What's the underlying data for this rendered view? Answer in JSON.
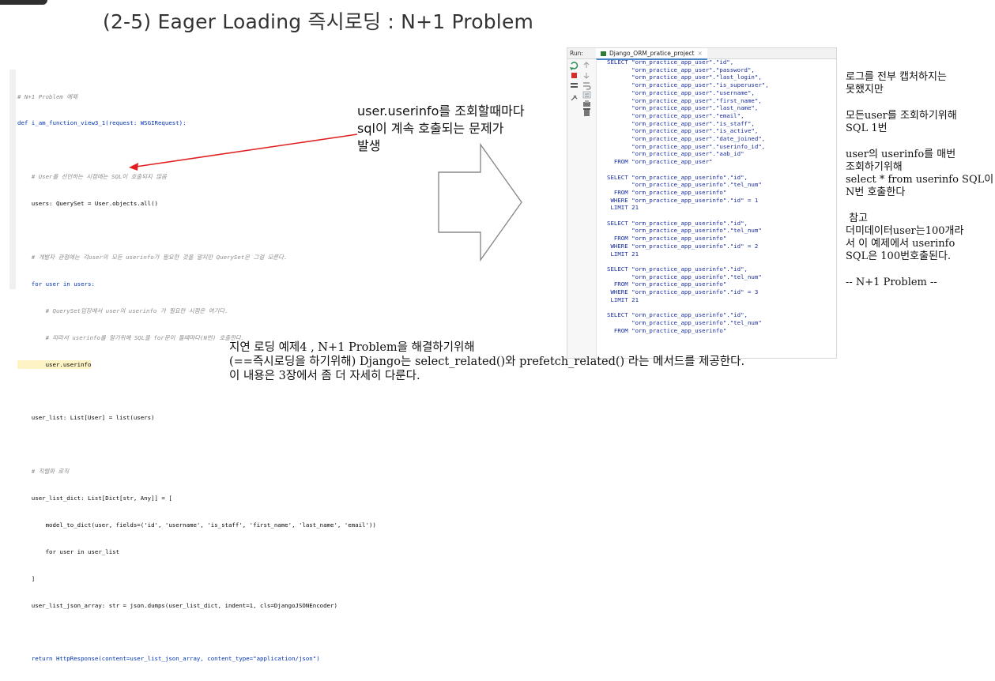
{
  "slide": {
    "title": "(2-5) Eager Loading 즉시로딩 : N+1 Problem"
  },
  "code": {
    "lines": [
      "# N+1 Problem 예제",
      "def i_am_function_view3_1(request: WSGIRequest):",
      "",
      "    # User를 선언하는 시점에는 SQL이 호출되지 않음",
      "    users: QuerySet = User.objects.all()",
      "",
      "    # 개발자 관점에는 각user의 모든 userinfo가 필요한 것을 알지만 QuerySet은 그걸 모른다.",
      "    for user in users:",
      "        # QuerySet입장에서 user의 userinfo 가 필요한 시점은 여기다.",
      "        # 따라서 userinfo를 알기위해 SQL을 for문이 돌때마다(N번) 호출한다.",
      "        user.userinfo",
      "",
      "    user_list: List[User] = list(users)",
      "",
      "    # 직렬화 로직",
      "    user_list_dict: List[Dict[str, Any]] = [",
      "        model_to_dict(user, fields=('id', 'username', 'is_staff', 'first_name', 'last_name', 'email'))",
      "        for user in user_list",
      "    ]",
      "    user_list_json_array: str = json.dumps(user_list_dict, indent=1, cls=DjangoJSONEncoder)",
      "",
      "    return HttpResponse(content=user_list_json_array, content_type=\"application/json\")"
    ]
  },
  "annotation": {
    "line1": "user.userinfo를 조회할때마다",
    "line2": "sql이 계속 호출되는 문제가",
    "line3": "발생"
  },
  "console": {
    "run_label": "Run:",
    "tab_label": "Django_ORM_pratice_project",
    "close_glyph": "×",
    "sql_text": "SELECT \"orm_practice_app_user\".\"id\",\n       \"orm_practice_app_user\".\"password\",\n       \"orm_practice_app_user\".\"last_login\",\n       \"orm_practice_app_user\".\"is_superuser\",\n       \"orm_practice_app_user\".\"username\",\n       \"orm_practice_app_user\".\"first_name\",\n       \"orm_practice_app_user\".\"last_name\",\n       \"orm_practice_app_user\".\"email\",\n       \"orm_practice_app_user\".\"is_staff\",\n       \"orm_practice_app_user\".\"is_active\",\n       \"orm_practice_app_user\".\"date_joined\",\n       \"orm_practice_app_user\".\"userinfo_id\",\n       \"orm_practice_app_user\".\"aab_id\"\n  FROM \"orm_practice_app_user\"\n\nSELECT \"orm_practice_app_userinfo\".\"id\",\n       \"orm_practice_app_userinfo\".\"tel_num\"\n  FROM \"orm_practice_app_userinfo\"\n WHERE \"orm_practice_app_userinfo\".\"id\" = 1\n LIMIT 21\n\nSELECT \"orm_practice_app_userinfo\".\"id\",\n       \"orm_practice_app_userinfo\".\"tel_num\"\n  FROM \"orm_practice_app_userinfo\"\n WHERE \"orm_practice_app_userinfo\".\"id\" = 2\n LIMIT 21\n\nSELECT \"orm_practice_app_userinfo\".\"id\",\n       \"orm_practice_app_userinfo\".\"tel_num\"\n  FROM \"orm_practice_app_userinfo\"\n WHERE \"orm_practice_app_userinfo\".\"id\" = 3\n LIMIT 21\n\nSELECT \"orm_practice_app_userinfo\".\"id\",\n       \"orm_practice_app_userinfo\".\"tel_num\"\n  FROM \"orm_practice_app_userinfo\""
  },
  "notes": {
    "n1": "로그를 전부 캡처하지는",
    "n2": "못했지만",
    "n3": "모든user를 조회하기위해",
    "n4": "SQL 1번",
    "n5": "user의 userinfo를 매번",
    "n6": "조회하기위해",
    "n7": "select * from userinfo SQL이",
    "n8": "N번 호출한다",
    "n9": " 참고",
    "n10": "더미데이터user는100개라",
    "n11": "서 이 예제에서 userinfo",
    "n12": "SQL은 100번호출된다.",
    "n13": "-- N+1 Problem --"
  },
  "bottom": {
    "line1": "지연 로딩 예제4 , N+1 Problem을 해결하기위해",
    "line2": "(==즉시로딩을 하기위해) Django는 select_related()와 prefetch_related() 라는 메서드를 제공한다.",
    "line3": "이 내용은 3장에서 좀 더 자세히 다룬다."
  },
  "colors": {
    "console_sql": "#1a2fa0",
    "code_comment": "#8c8c8c",
    "code_keyword": "#0033b3",
    "annotation_arrow": "#e02020"
  }
}
